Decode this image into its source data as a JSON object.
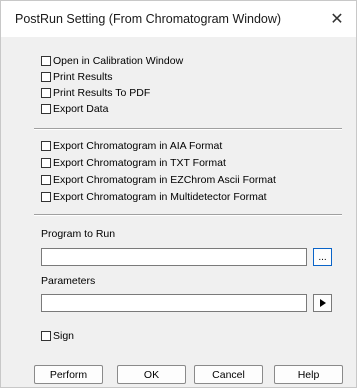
{
  "dialog": {
    "title": "PostRun Setting (From Chromatogram Window)"
  },
  "options_group1": [
    {
      "label": "Open in Calibration Window",
      "checked": false
    },
    {
      "label": "Print Results",
      "checked": false
    },
    {
      "label": "Print Results To PDF",
      "checked": false
    },
    {
      "label": "Export Data",
      "checked": false
    }
  ],
  "options_group2": [
    {
      "label": "Export Chromatogram in AIA Format",
      "checked": false
    },
    {
      "label": "Export Chromatogram in TXT Format",
      "checked": false
    },
    {
      "label": "Export Chromatogram in EZChrom Ascii Format",
      "checked": false
    },
    {
      "label": "Export Chromatogram in Multidetector Format",
      "checked": false
    }
  ],
  "program": {
    "label": "Program to Run",
    "value": "",
    "browse_label": "..."
  },
  "parameters": {
    "label": "Parameters",
    "value": ""
  },
  "sign": {
    "label": "Sign",
    "checked": false
  },
  "buttons": {
    "perform": "Perform",
    "ok": "OK",
    "cancel": "Cancel",
    "help": "Help"
  }
}
